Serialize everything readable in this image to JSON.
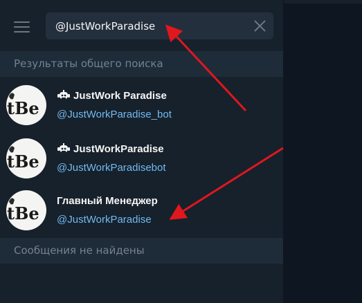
{
  "search": {
    "value": "@JustWorkParadise"
  },
  "sections": {
    "global_results": "Результаты общего поиска",
    "messages_not_found": "Сообщения не найдены"
  },
  "results": [
    {
      "name": "JustWork Paradise",
      "username": "@JustWorkParadise_bot",
      "is_bot": true
    },
    {
      "name": "JustWorkParadise",
      "username": "@JustWorkParadisebot",
      "is_bot": true
    },
    {
      "name": "Главный Менеджер",
      "username": "@JustWorkParadise",
      "is_bot": false
    }
  ],
  "avatar_glyph": "tBe",
  "colors": {
    "sidebar_bg": "#17212b",
    "chat_bg": "#0e1621",
    "search_bg": "#242f3d",
    "section_bg": "#1e2c3a",
    "username_link": "#71baf1",
    "annotation_arrow": "#e0171e"
  },
  "icons": [
    "menu-icon",
    "clear-icon",
    "bot-icon"
  ]
}
